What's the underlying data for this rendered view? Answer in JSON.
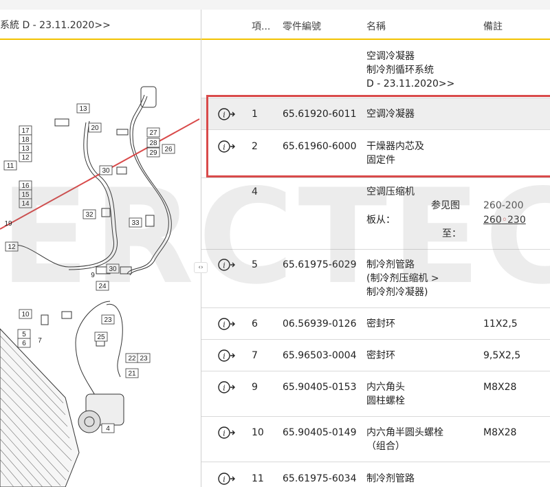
{
  "breadcrumb": "系統 D - 23.11.2020>>",
  "split_handle_glyph": "‹›",
  "watermark": "ERCTECH",
  "table": {
    "headers": {
      "item": "項...",
      "part_no": "零件編號",
      "name": "名稱",
      "remark": "備註"
    },
    "group_header": {
      "line1": "空调冷凝器",
      "line2": "制冷剂循环系统",
      "line3": "D - 23.11.2020>>"
    },
    "rows": [
      {
        "item": "1",
        "part": "65.61920-6011",
        "name1": "空调冷凝器",
        "name2": "",
        "remark": ""
      },
      {
        "item": "2",
        "part": "65.61960-6000",
        "name1": "干燥器内芯及",
        "name2": "固定件",
        "remark": ""
      },
      {
        "item": "4",
        "part": "",
        "name1": "空调压缩机",
        "ref_label": "参见图",
        "ref_value": "260-200",
        "from_label": "板从：",
        "from_a": "260",
        "from_b": "230",
        "to_label": "至："
      },
      {
        "item": "5",
        "part": "65.61975-6029",
        "name1": "制冷剂管路",
        "name2": "(制冷剂压缩机 >",
        "name3": " 制冷剂冷凝器)",
        "remark": ""
      },
      {
        "item": "6",
        "part": "06.56939-0126",
        "name1": "密封环",
        "name2": "",
        "remark": "11X2,5"
      },
      {
        "item": "7",
        "part": "65.96503-0004",
        "name1": "密封环",
        "name2": "",
        "remark": "9,5X2,5"
      },
      {
        "item": "9",
        "part": "65.90405-0153",
        "name1": "内六角头",
        "name2": "圆柱螺栓",
        "remark": "M8X28"
      },
      {
        "item": "10",
        "part": "65.90405-0149",
        "name1": "内六角半圆头螺栓",
        "name2": "（组合）",
        "remark": "M8X28"
      },
      {
        "item": "11",
        "part": "65.61975-6034",
        "name1": "制冷剂管路",
        "name2": "",
        "remark": ""
      }
    ]
  },
  "diagram_labels": [
    "13",
    "20",
    "17",
    "18",
    "13",
    "12",
    "11",
    "27",
    "28",
    "29",
    "26",
    "30",
    "16",
    "15",
    "14",
    "32",
    "33",
    "19",
    "12",
    "30",
    "9",
    "24",
    "10",
    "23",
    "5",
    "6",
    "25",
    "22",
    "23",
    "21",
    "7",
    "4"
  ],
  "colors": {
    "accent": "#f2c200",
    "highlight": "#d94a4a"
  }
}
